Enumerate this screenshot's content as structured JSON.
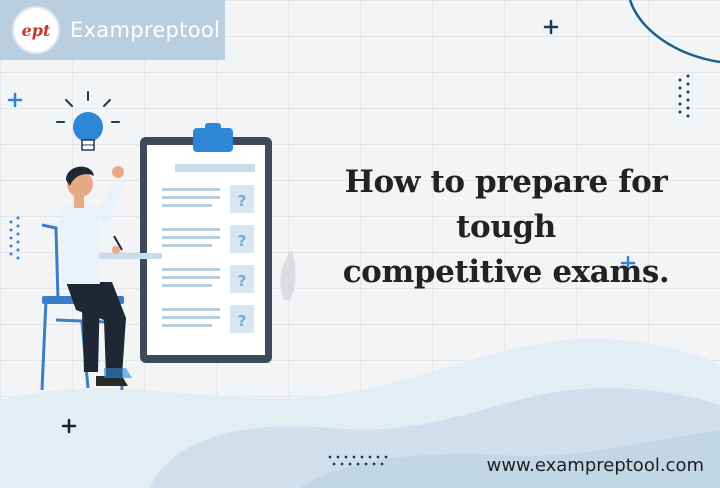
{
  "brand": {
    "logo_text": "ept",
    "name": "Exampreptool"
  },
  "headline": {
    "line1": "How to prepare for tough",
    "line2": "competitive exams."
  },
  "footer": {
    "url": "www.exampreptool.com"
  },
  "clipboard": {
    "question_marks": [
      "?",
      "?",
      "?",
      "?"
    ]
  },
  "colors": {
    "brand_bar": "#b9cfdf",
    "accent_blue": "#1f5f8b",
    "wave_light": "#dbe8f1",
    "wave_mid": "#c4d9e8",
    "clipboard_frame": "#3d4a5c",
    "bulb_blue": "#2f86d6"
  },
  "icons": [
    "plus-icon",
    "lightbulb-icon",
    "dotted-line-decoration"
  ]
}
